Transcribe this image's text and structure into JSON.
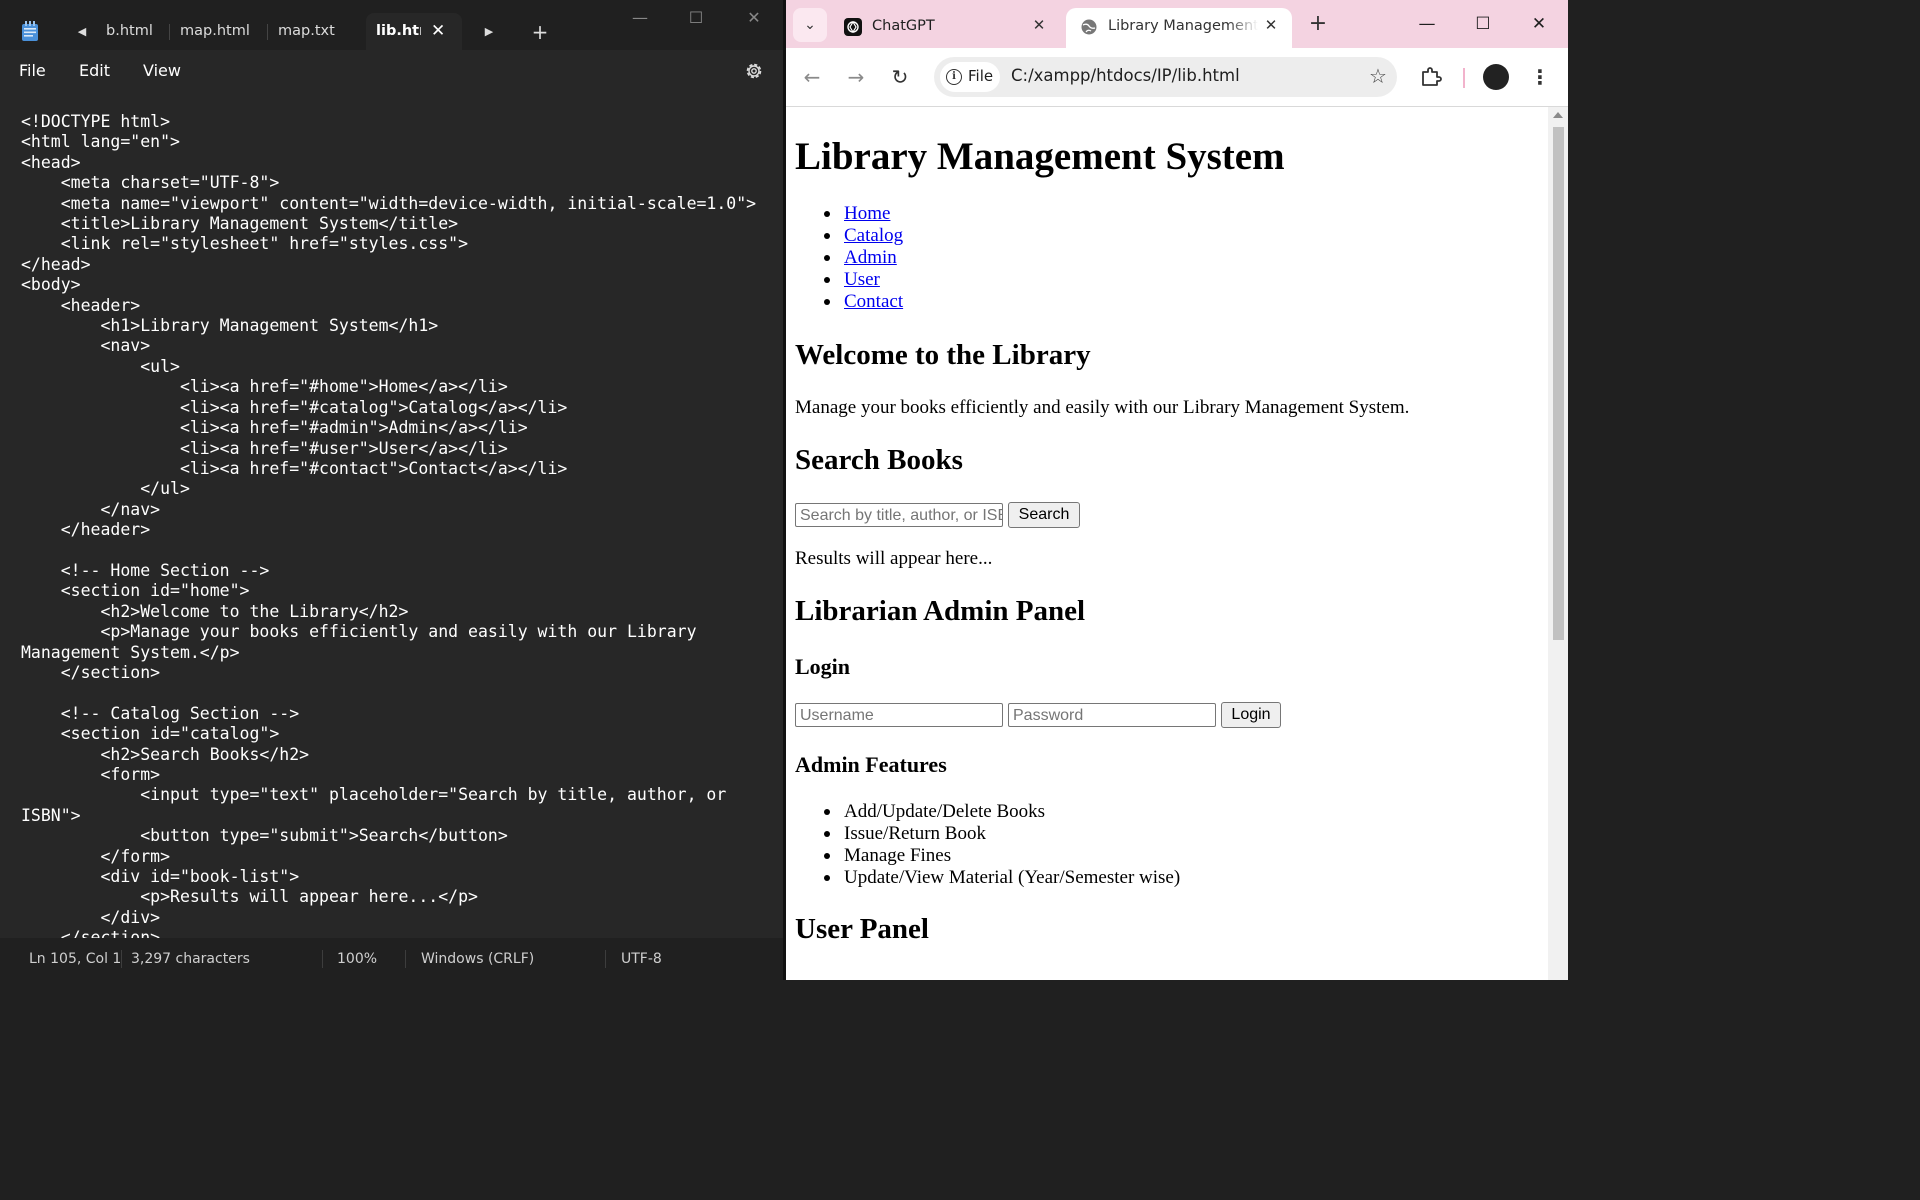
{
  "notepad": {
    "tabs": [
      {
        "label": "b.html"
      },
      {
        "label": "map.html"
      },
      {
        "label": "map.txt"
      },
      {
        "label": "lib.html",
        "active": true
      }
    ],
    "menu": [
      "File",
      "Edit",
      "View"
    ],
    "code_lines": [
      "<!DOCTYPE html>",
      "<html lang=\"en\">",
      "<head>",
      "    <meta charset=\"UTF-8\">",
      "    <meta name=\"viewport\" content=\"width=device-width, initial-scale=1.0\">",
      "    <title>Library Management System</title>",
      "    <link rel=\"stylesheet\" href=\"styles.css\">",
      "</head>",
      "<body>",
      "    <header>",
      "        <h1>Library Management System</h1>",
      "        <nav>",
      "            <ul>",
      "                <li><a href=\"#home\">Home</a></li>",
      "                <li><a href=\"#catalog\">Catalog</a></li>",
      "                <li><a href=\"#admin\">Admin</a></li>",
      "                <li><a href=\"#user\">User</a></li>",
      "                <li><a href=\"#contact\">Contact</a></li>",
      "            </ul>",
      "        </nav>",
      "    </header>",
      "",
      "    <!-- Home Section -->",
      "    <section id=\"home\">",
      "        <h2>Welcome to the Library</h2>",
      "        <p>Manage your books efficiently and easily with our Library",
      "Management System.</p>",
      "    </section>",
      "",
      "    <!-- Catalog Section -->",
      "    <section id=\"catalog\">",
      "        <h2>Search Books</h2>",
      "        <form>",
      "            <input type=\"text\" placeholder=\"Search by title, author, or",
      "ISBN\">",
      "            <button type=\"submit\">Search</button>",
      "        </form>",
      "        <div id=\"book-list\">",
      "            <p>Results will appear here...</p>",
      "        </div>",
      "    </section>"
    ],
    "status": {
      "position": "Ln 105, Col 1",
      "chars": "3,297 characters",
      "zoom": "100%",
      "line_ending": "Windows (CRLF)",
      "encoding": "UTF-8"
    }
  },
  "chrome": {
    "tabs": [
      {
        "title": "ChatGPT",
        "icon": "chatgpt-icon"
      },
      {
        "title": "Library Management System",
        "icon": "globe-icon",
        "active": true
      }
    ],
    "address": {
      "badge": "File",
      "url": "C:/xampp/htdocs/IP/lib.html"
    },
    "page": {
      "h1": "Library Management System",
      "nav": [
        "Home",
        "Catalog",
        "Admin",
        "User",
        "Contact"
      ],
      "home_heading": "Welcome to the Library",
      "home_text": "Manage your books efficiently and easily with our Library Management System.",
      "catalog_heading": "Search Books",
      "search_placeholder": "Search by title, author, or ISBN",
      "search_button": "Search",
      "results_text": "Results will appear here...",
      "admin_heading": "Librarian Admin Panel",
      "login_heading": "Login",
      "username_placeholder": "Username",
      "password_placeholder": "Password",
      "login_button": "Login",
      "features_heading": "Admin Features",
      "features": [
        "Add/Update/Delete Books",
        "Issue/Return Book",
        "Manage Fines",
        "Update/View Material (Year/Semester wise)"
      ],
      "user_heading": "User Panel"
    }
  }
}
